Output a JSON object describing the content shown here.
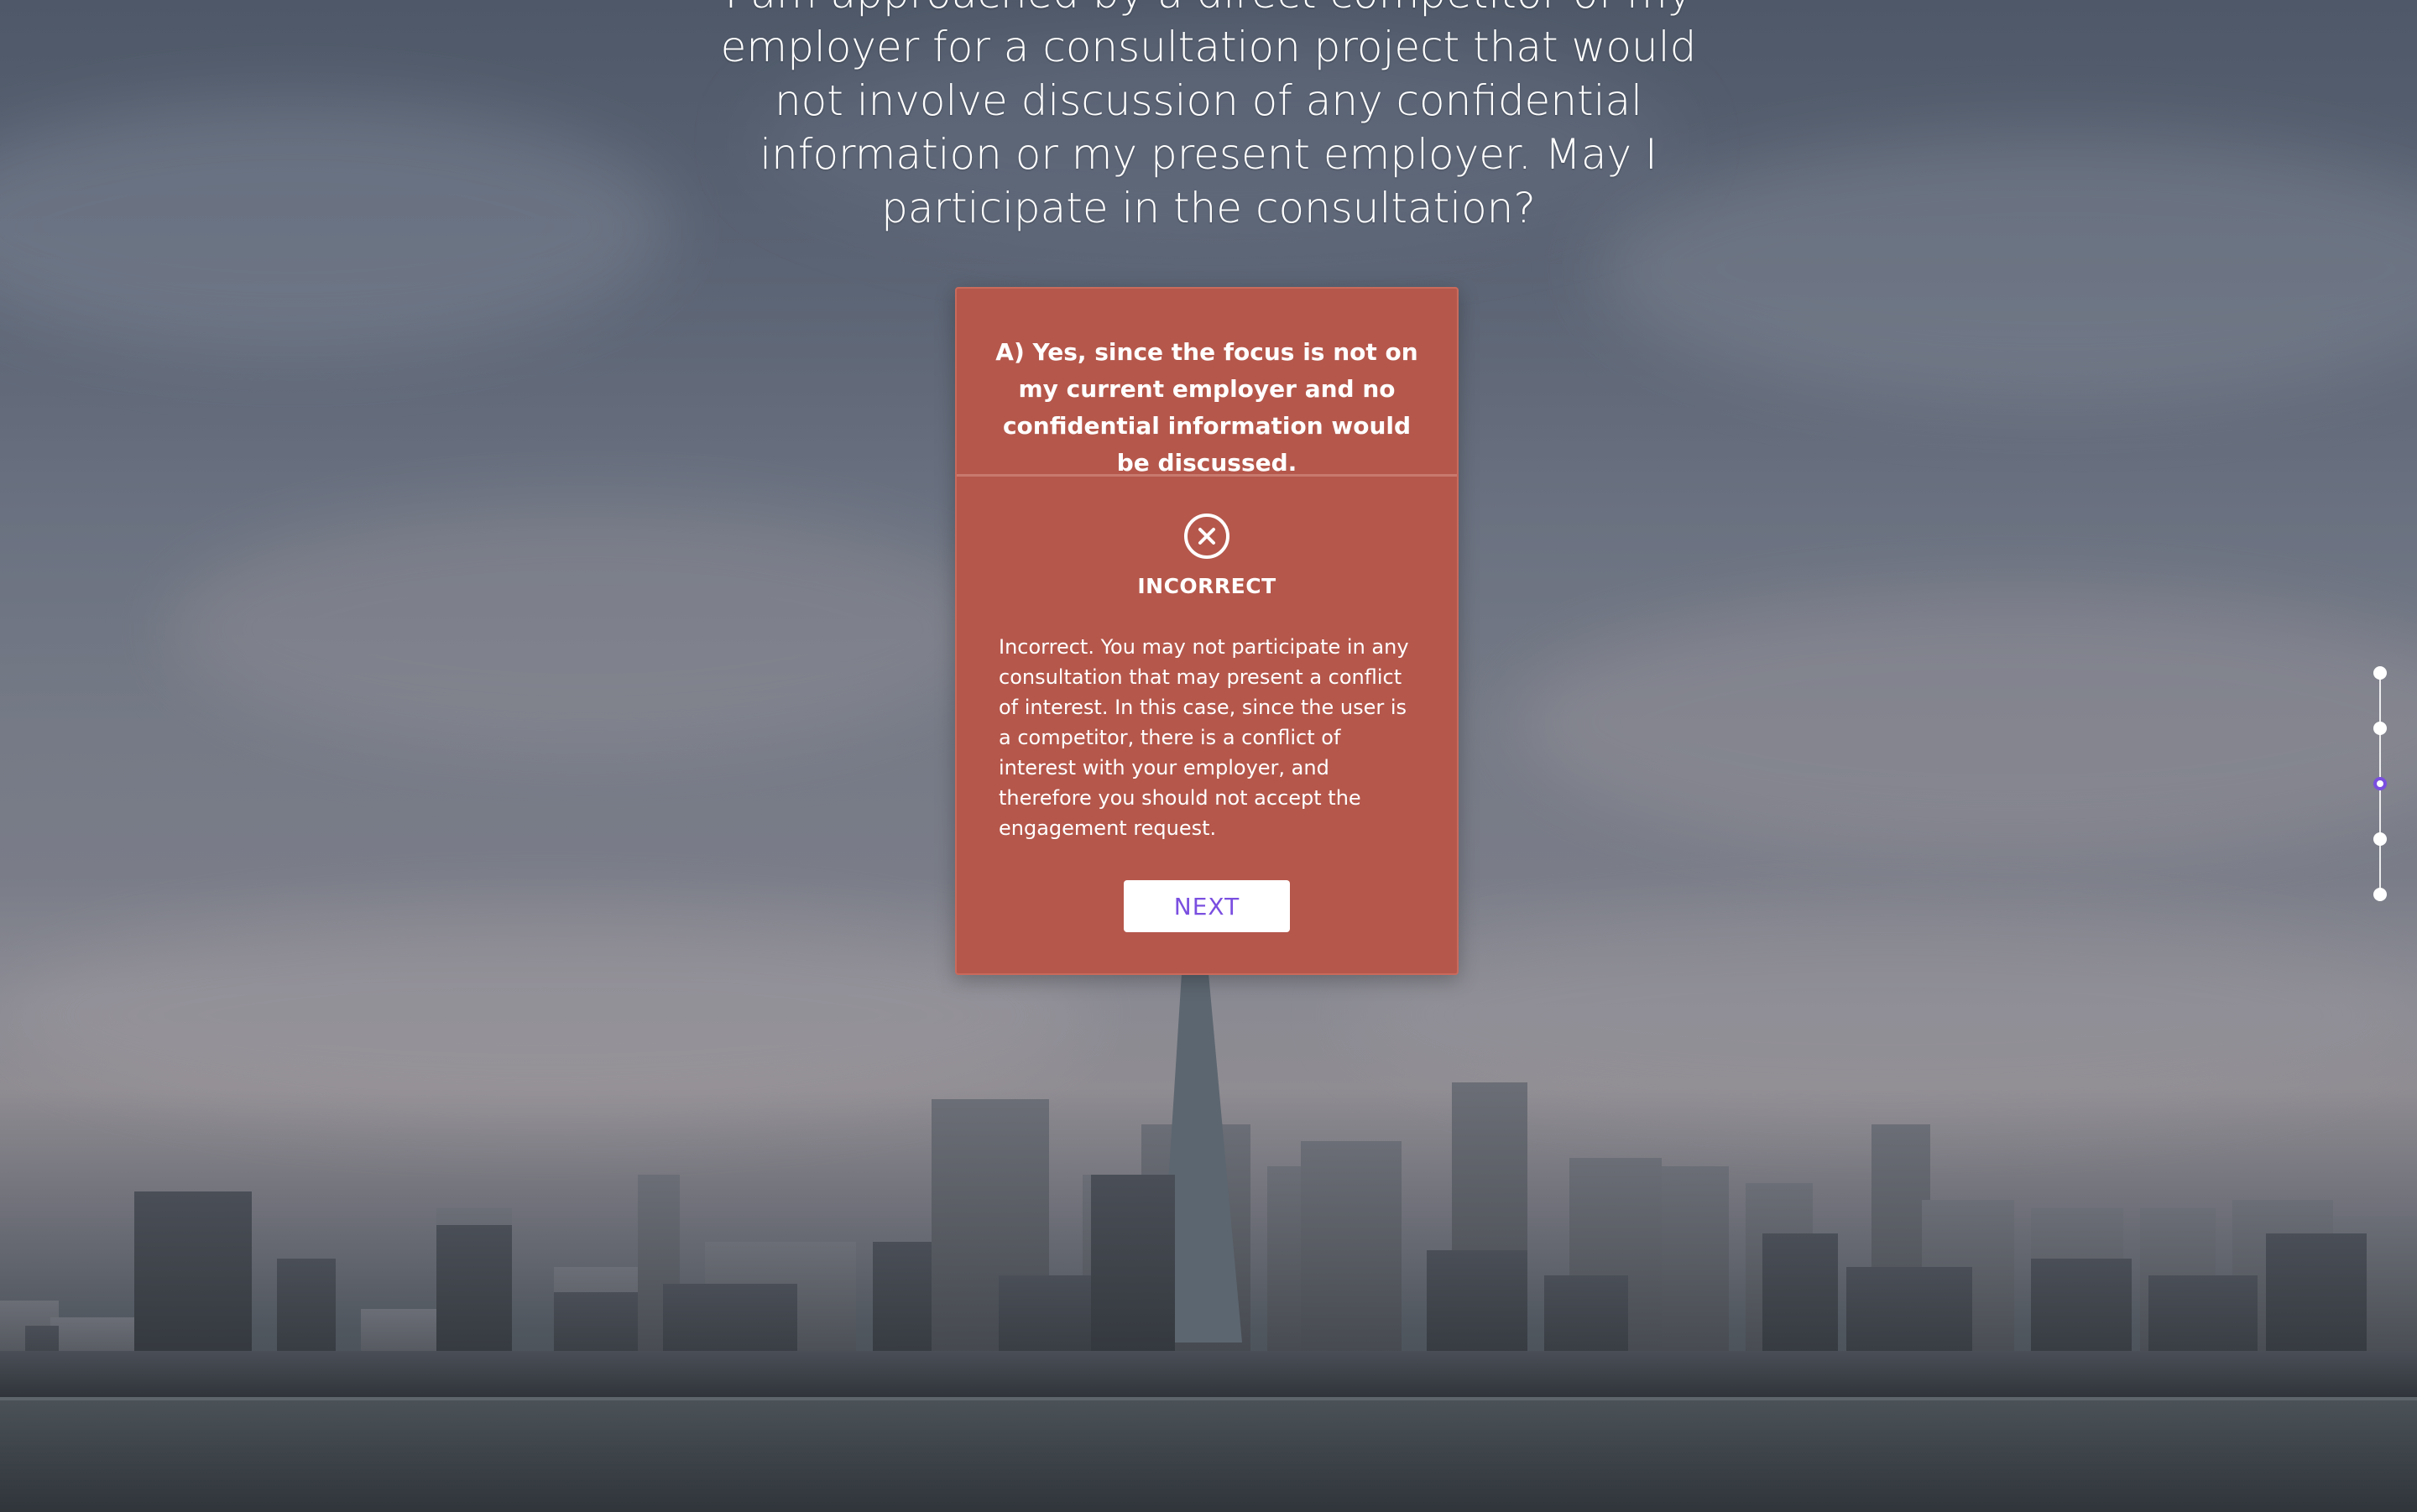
{
  "question": {
    "text": "I am approached by a direct competitor of my employer for a consultation project that would not involve discussion of any confidential information or my present employer. May I participate in the consultation?"
  },
  "answer": {
    "text": "A) Yes, since the focus is not on my current employer and no confidential information would be discussed."
  },
  "feedback": {
    "icon": "circle-x-icon",
    "label": "INCORRECT",
    "explanation": "Incorrect. You may not participate in any consultation that may present a conflict of interest. In this case, since the user is a competitor, there is a conflict of interest with your employer, and therefore you should not accept the engagement request.",
    "next_label": "NEXT"
  },
  "progress": {
    "total": 5,
    "current": 3
  },
  "colors": {
    "card_background": "#b5574b",
    "accent": "#7a4fe0",
    "text": "#ffffff"
  }
}
